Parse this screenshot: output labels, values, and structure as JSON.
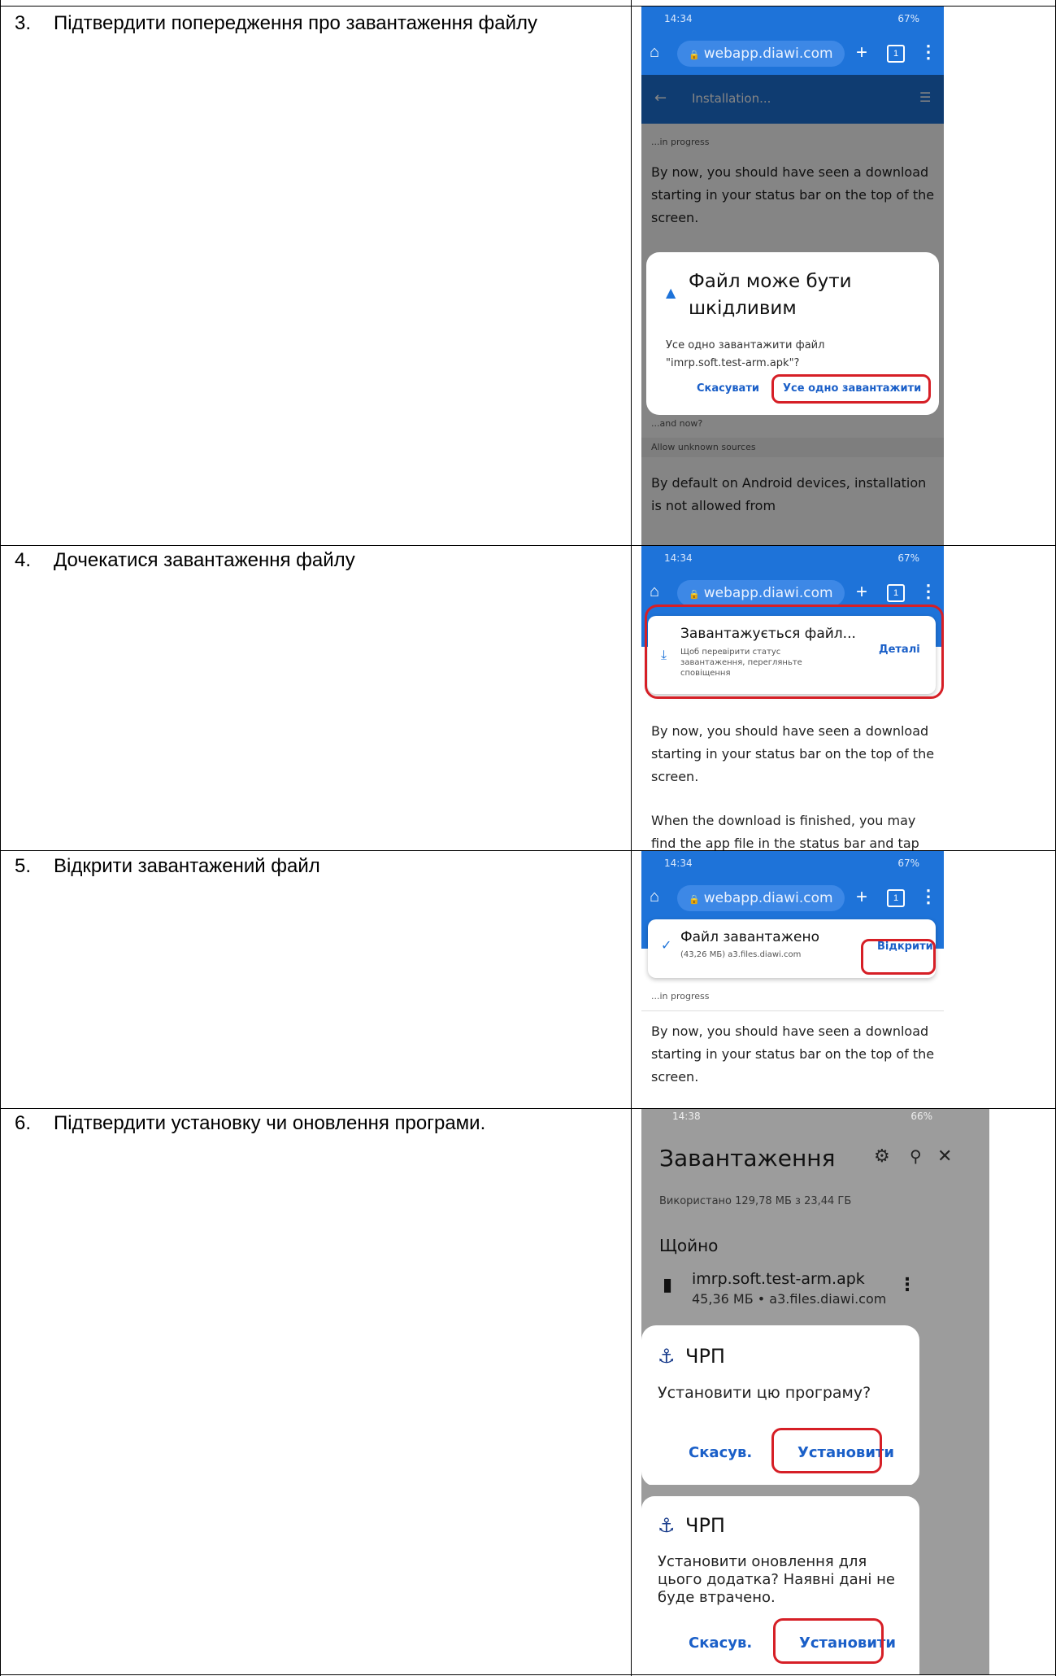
{
  "steps": [
    {
      "num": "3.",
      "text": "Підтвердити попередження про завантаження файлу"
    },
    {
      "num": "4.",
      "text": "Дочекатися завантаження файлу"
    },
    {
      "num": "5.",
      "text": "Відкрити завантажений файл"
    },
    {
      "num": "6.",
      "text": "Підтвердити установку чи оновлення програми."
    }
  ],
  "browser": {
    "time": "14:34",
    "battery": "67%",
    "url": "webapp.diawi.com",
    "tab_count": "1"
  },
  "shot3": {
    "page_title": "Installation...",
    "in_progress": "...in progress",
    "body": "By now, you should have seen a download starting in your status bar on the top of the screen.",
    "dialog_title": "Файл може бути шкідливим",
    "dialog_text": "Усе одно завантажити файл \"imrp.soft.test-arm.apk\"?",
    "cancel": "Скасувати",
    "confirm": "Усе одно завантажити",
    "and_now": "...and now?",
    "allow_sources": "Allow unknown sources",
    "body2": "By default on Android devices, installation is not allowed from"
  },
  "shot4": {
    "toast_title": "Завантажується файл...",
    "toast_text": "Щоб перевірити статус завантаження, перегляньте сповіщення",
    "details": "Деталі",
    "body": "By now, you should have seen a download starting in your status bar on the top of the screen.",
    "body2": "When the download is finished, you may find the app file in the status bar and tap"
  },
  "shot5": {
    "toast_title": "Файл завантажено",
    "toast_text": "(43,26 МБ) a3.files.diawi.com",
    "open": "Відкрити",
    "in_progress": "...in progress",
    "body": "By now, you should have seen a download starting in your status bar on the top of the screen."
  },
  "shot6": {
    "time": "14:38",
    "battery": "66%",
    "title": "Завантаження",
    "used": "Використано 129,78 МБ з 23,44 ГБ",
    "section": "Щойно",
    "file_name": "imrp.soft.test-arm.apk",
    "file_meta": "45,36 МБ • a3.files.diawi.com",
    "app_name": "ЧРП",
    "install_q": "Установити цю програму?",
    "cancel": "Скасув.",
    "install": "Установити",
    "app_name2": "ЧРП",
    "update_q": "Установити оновлення для цього додатка? Наявні дані не буде втрачено.",
    "cancel2": "Скасув.",
    "install2": "Установити"
  },
  "colors": {
    "accent": "#1e73d9",
    "highlight": "#d61f26",
    "button_text": "#1a5fc8"
  }
}
